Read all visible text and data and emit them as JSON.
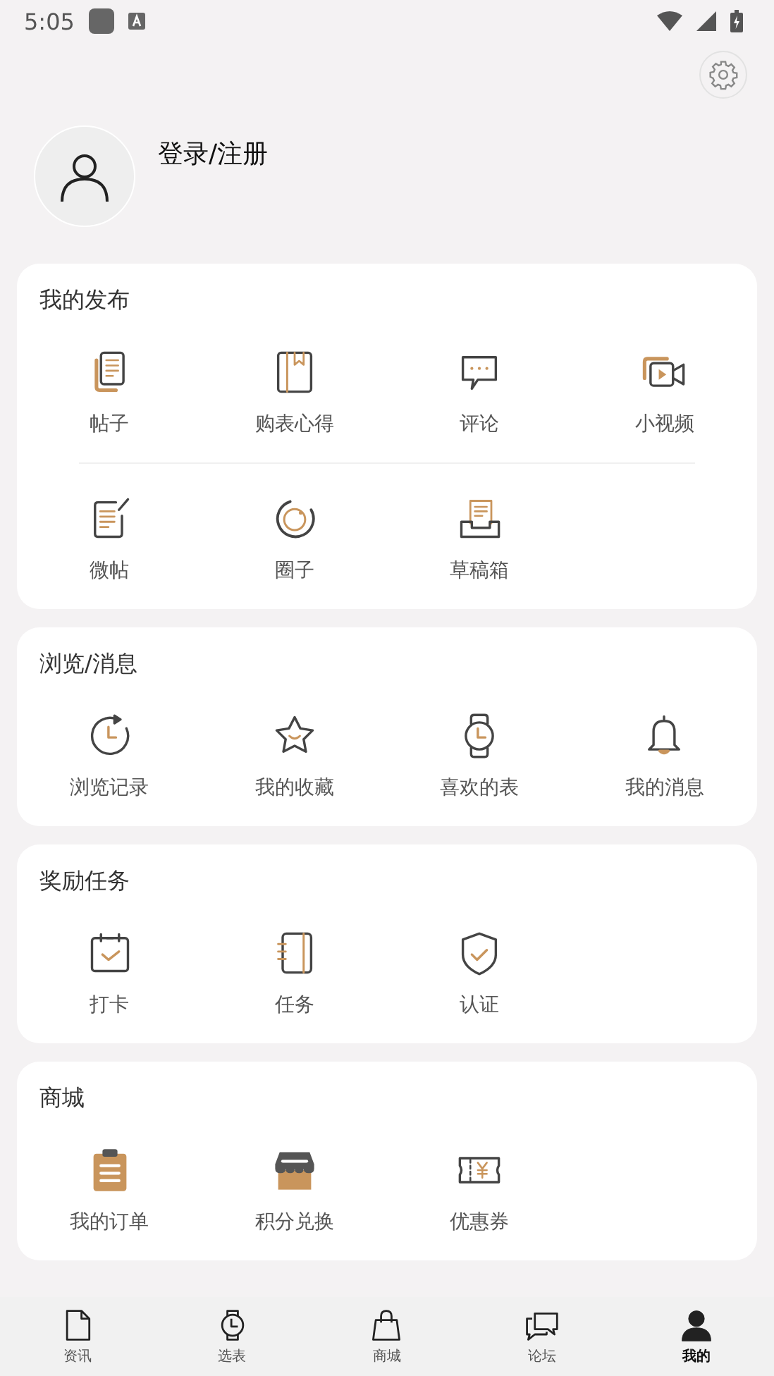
{
  "status_bar": {
    "time": "5:05"
  },
  "profile": {
    "login_label": "登录/注册"
  },
  "sections": [
    {
      "title": "我的发布",
      "rows": [
        [
          {
            "label": "帖子"
          },
          {
            "label": "购表心得"
          },
          {
            "label": "评论"
          },
          {
            "label": "小视频"
          }
        ],
        [
          {
            "label": "微帖"
          },
          {
            "label": "圈子"
          },
          {
            "label": "草稿箱"
          }
        ]
      ]
    },
    {
      "title": "浏览/消息",
      "rows": [
        [
          {
            "label": "浏览记录"
          },
          {
            "label": "我的收藏"
          },
          {
            "label": "喜欢的表"
          },
          {
            "label": "我的消息"
          }
        ]
      ]
    },
    {
      "title": "奖励任务",
      "rows": [
        [
          {
            "label": "打卡"
          },
          {
            "label": "任务"
          },
          {
            "label": "认证"
          }
        ]
      ]
    },
    {
      "title": "商城",
      "rows": [
        [
          {
            "label": "我的订单"
          },
          {
            "label": "积分兑换"
          },
          {
            "label": "优惠券"
          }
        ]
      ]
    }
  ],
  "bottom_nav": [
    {
      "label": "资讯",
      "selected": false
    },
    {
      "label": "选表",
      "selected": false
    },
    {
      "label": "商城",
      "selected": false
    },
    {
      "label": "论坛",
      "selected": false
    },
    {
      "label": "我的",
      "selected": true
    }
  ]
}
